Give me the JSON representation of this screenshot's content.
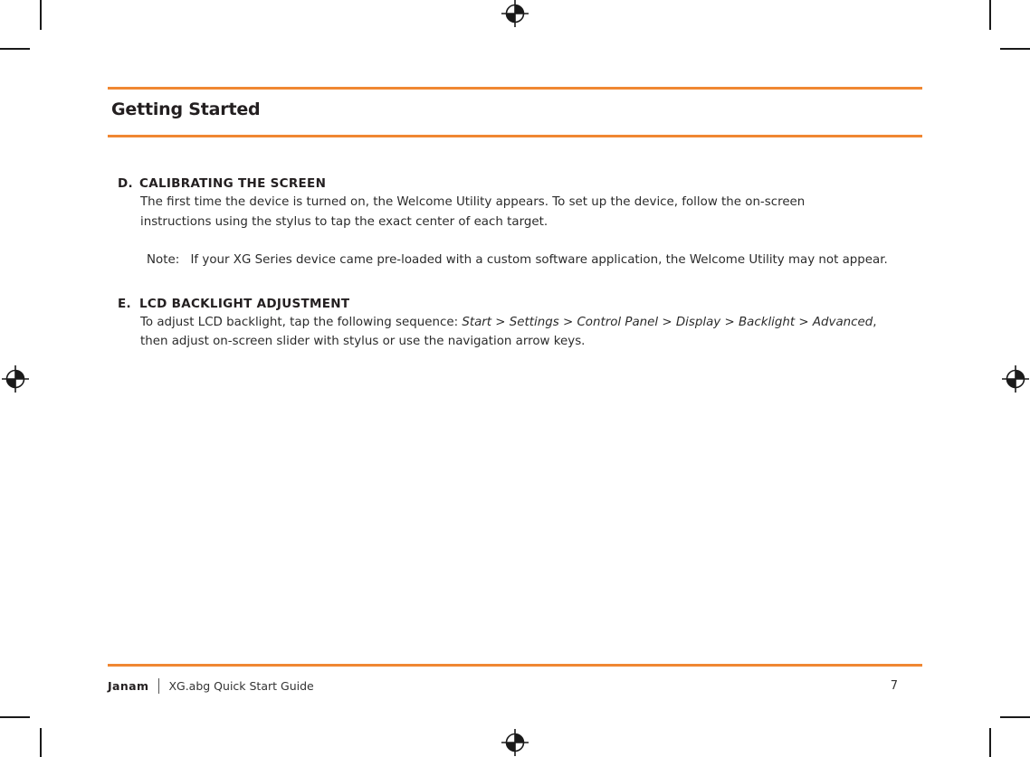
{
  "header": {
    "title": "Getting Started",
    "accent_color": "#f08732"
  },
  "sections": [
    {
      "letter": "D.",
      "title": "CALIBRATING THE SCREEN",
      "body_line_1": "The first time the device is turned on, the Welcome Utility appears.  To set up the device, follow the on-screen",
      "body_line_2": "instructions using the stylus to tap the exact center of each target.",
      "note_label": "Note:",
      "note_text": "If your XG Series device came pre-loaded with a custom software application, the Welcome Utility may not appear."
    },
    {
      "letter": "E.",
      "title": "LCD BACKLIGHT ADJUSTMENT",
      "body_lead": "To adjust LCD backlight, tap the following sequence: ",
      "body_path": "Start > Settings > Control Panel > Display > Backlight > Advanced",
      "body_tail": ",",
      "body_line_2": "then adjust on-screen slider with stylus or use the navigation arrow keys."
    }
  ],
  "footer": {
    "brand": "Janam",
    "document": "XG.abg Quick Start Guide",
    "page_number": "7"
  }
}
